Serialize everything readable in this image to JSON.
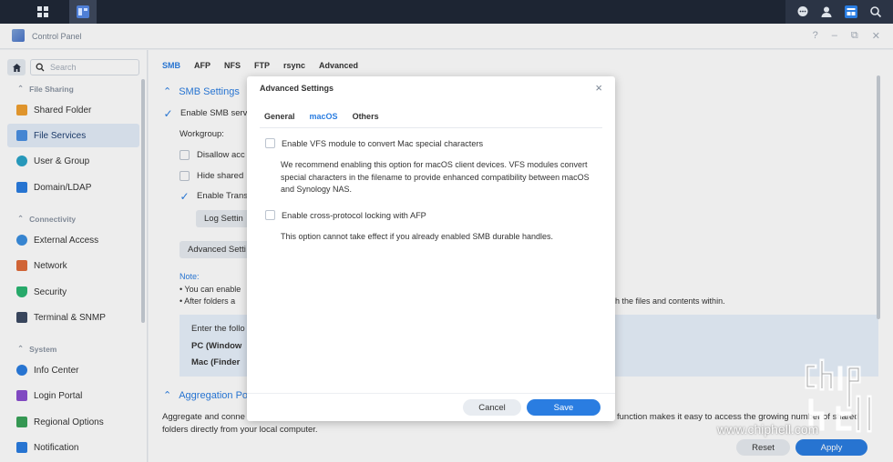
{
  "window": {
    "title": "Control Panel"
  },
  "sidebar": {
    "search_placeholder": "Search",
    "categories": [
      {
        "label": "File Sharing"
      },
      {
        "label": "Connectivity"
      },
      {
        "label": "System"
      }
    ],
    "items": [
      {
        "label": "Shared Folder",
        "icon": "shared-folder-icon",
        "color": "#f0a030"
      },
      {
        "label": "File Services",
        "icon": "file-services-icon",
        "color": "#4a90e2",
        "active": true
      },
      {
        "label": "User & Group",
        "icon": "user-group-icon",
        "color": "#2aa4c9"
      },
      {
        "label": "Domain/LDAP",
        "icon": "domain-ldap-icon",
        "color": "#2a7de1"
      },
      {
        "label": "External Access",
        "icon": "external-access-icon",
        "color": "#3b8fe0"
      },
      {
        "label": "Network",
        "icon": "network-icon",
        "color": "#e06c3b"
      },
      {
        "label": "Security",
        "icon": "security-icon",
        "color": "#2bb673"
      },
      {
        "label": "Terminal & SNMP",
        "icon": "terminal-icon",
        "color": "#3d4b63"
      },
      {
        "label": "Info Center",
        "icon": "info-center-icon",
        "color": "#2a7de1"
      },
      {
        "label": "Login Portal",
        "icon": "login-portal-icon",
        "color": "#8a4fd0"
      },
      {
        "label": "Regional Options",
        "icon": "regional-options-icon",
        "color": "#3aa35a"
      },
      {
        "label": "Notification",
        "icon": "notification-icon",
        "color": "#2a7de1"
      }
    ]
  },
  "main": {
    "tabs": [
      "SMB",
      "AFP",
      "NFS",
      "FTP",
      "rsync",
      "Advanced"
    ],
    "active_tab": "SMB",
    "smb_section_title": "SMB Settings",
    "enable_smb": "Enable SMB serv",
    "workgroup_label": "Workgroup:",
    "disallow": "Disallow acc",
    "hide_shared": "Hide shared",
    "enable_transfer": "Enable Trans",
    "log_settings_btn": "Log Settin",
    "advanced_settings_btn": "Advanced Setti",
    "note_label": "Note:",
    "note_line1": "• You can enable",
    "note_line2": "• After folders a",
    "note_line2_tail": "h the files and contents within.",
    "info_line1": "Enter the follo",
    "info_pc": "PC (Window",
    "info_mac": "Mac (Finder",
    "aggregation_title": "Aggregation Po",
    "bottom_line1_start": "Aggregate and conne",
    "bottom_line1_tail": "function makes it easy to access the growing number of shared",
    "bottom_line2": "folders directly from your local computer.",
    "reset_btn": "Reset",
    "apply_btn": "Apply"
  },
  "dialog": {
    "title": "Advanced Settings",
    "tabs": [
      "General",
      "macOS",
      "Others"
    ],
    "active_tab": "macOS",
    "option1_label": "Enable VFS module to convert Mac special characters",
    "option1_desc": "We recommend enabling this option for macOS client devices. VFS modules convert special characters in the filename to provide enhanced compatibility between macOS and Synology NAS.",
    "option2_label": "Enable cross-protocol locking with AFP",
    "option2_desc": "This option cannot take effect if you already enabled SMB durable handles.",
    "cancel_btn": "Cancel",
    "save_btn": "Save"
  },
  "watermark": {
    "text": "www.chiphell.com"
  },
  "colors": {
    "accent": "#2a7de1",
    "taskbar": "#1d2533",
    "info_bg": "#e8f1fc"
  }
}
